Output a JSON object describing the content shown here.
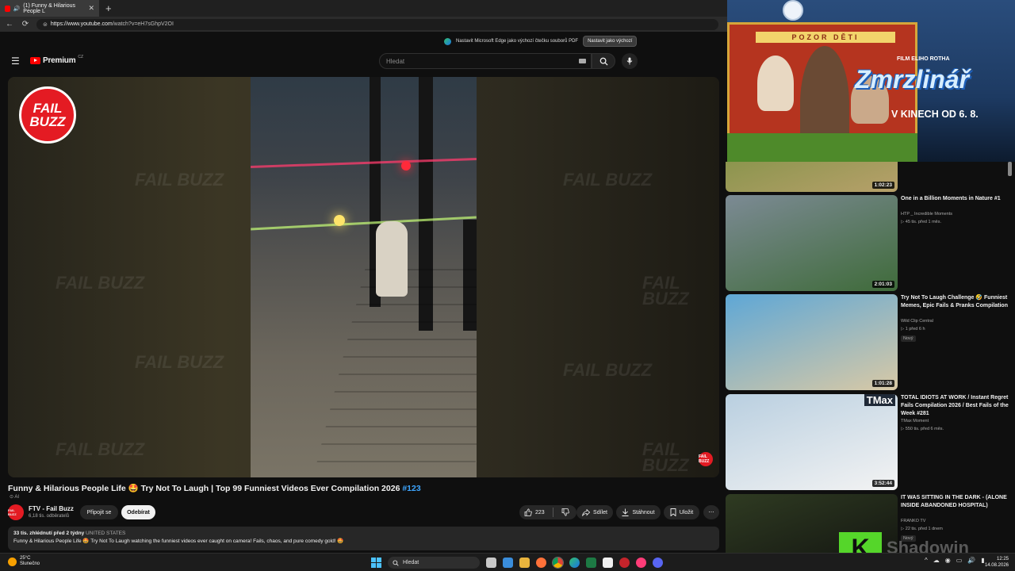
{
  "browser": {
    "tab_title": "(1) Funny & Hilarious People L",
    "tab_close": "✕",
    "new_tab": "+",
    "url_host": "https://www.youtube.com",
    "url_path": "/watch?v=eH7sGhpV2OI",
    "edge_prompt": "Nastavit Microsoft Edge jako výchozí čtečku souborů PDF",
    "edge_button": "Nastavit jako výchozí"
  },
  "youtube": {
    "logo": "Premium",
    "logo_region": "CZ",
    "search_placeholder": "Hledat"
  },
  "video": {
    "channel_logo_line1": "FAIL",
    "channel_logo_line2": "BUZZ",
    "watermark": "FAIL BUZZ",
    "corner_logo": "FAIL BUZZ",
    "title": "Funny & Hilarious People Life 🤩 Try Not To Laugh | Top 99 Funniest Videos Ever Compilation 2026",
    "hashtag": "#123",
    "ai_label": "⊙ AI"
  },
  "channel": {
    "avatar": "FAIL BUZZ",
    "name": "FTV - Fail Buzz",
    "subscribers": "6,18 tis. odběratelů",
    "join": "Připojit se",
    "subscribe": "Odebírat"
  },
  "actions": {
    "likes": "223",
    "share": "Sdílet",
    "download": "Stáhnout",
    "save": "Uložit",
    "more": "⋯"
  },
  "description": {
    "stats": "33 tis. zhlédnutí  před 2 týdny",
    "country": "UNITED STATES",
    "text": "Funny & Hilarious People Life 🤩 Try Not To Laugh watching the funniest videos ever caught on camera! Fails, chaos, and pure comedy gold! 🤩"
  },
  "ad": {
    "sign": "POZOR DĚTI",
    "film_label": "FILM ELIHO ROTHA",
    "title": "Zmrzlinář",
    "date": "V KINECH OD 6. 8."
  },
  "recommendations": [
    {
      "duration": "1:02:23",
      "title": "",
      "channel": "",
      "meta": "",
      "badge": "",
      "colors": [
        "#6d8d3a",
        "#b7a06a"
      ]
    },
    {
      "duration": "2:01:03",
      "title": "One in a Billion Moments in Nature #1",
      "channel": "HTP _ Incredible Moments",
      "meta": "▷ 45 tis.   před 1 měs.",
      "badge": "",
      "colors": [
        "#7c8a94",
        "#3f6b3a"
      ]
    },
    {
      "duration": "1:01:28",
      "title": "Try Not To Laugh Challenge 🤣 Funniest Memes, Epic Fails & Pranks Compilation",
      "channel": "Wild Clip Central",
      "meta": "▷ 1   před 6 h",
      "badge": "Nový",
      "colors": [
        "#5ea7d6",
        "#d8c9a6"
      ]
    },
    {
      "duration": "3:52:44",
      "title": "TOTAL IDIOTS AT WORK / Instant Regret Fails Compilation 2026 / Best Fails of the Week #281",
      "channel": "TMax Moment",
      "meta": "▷ 550 tis.   před 6 měs.",
      "badge": "",
      "thumb_label": "TMax",
      "colors": [
        "#b9cfe0",
        "#f3f3f3"
      ]
    },
    {
      "duration": "",
      "title": "IT WAS SITTING IN THE DARK - (ALONE INSIDE ABANDONED HOSPITAL)",
      "channel": "FRANKO TV",
      "meta": "▷ 22 tis.   před 1 dnem",
      "badge": "Nový",
      "colors": [
        "#2f3b22",
        "#0d0d0d"
      ]
    }
  ],
  "watermark_brand": {
    "letter": "K",
    "text": "Shadowin"
  },
  "taskbar": {
    "temperature": "25°C",
    "weather": "Slunečno",
    "search": "Hledat",
    "time": "12:25",
    "date": "14.08.2026"
  }
}
